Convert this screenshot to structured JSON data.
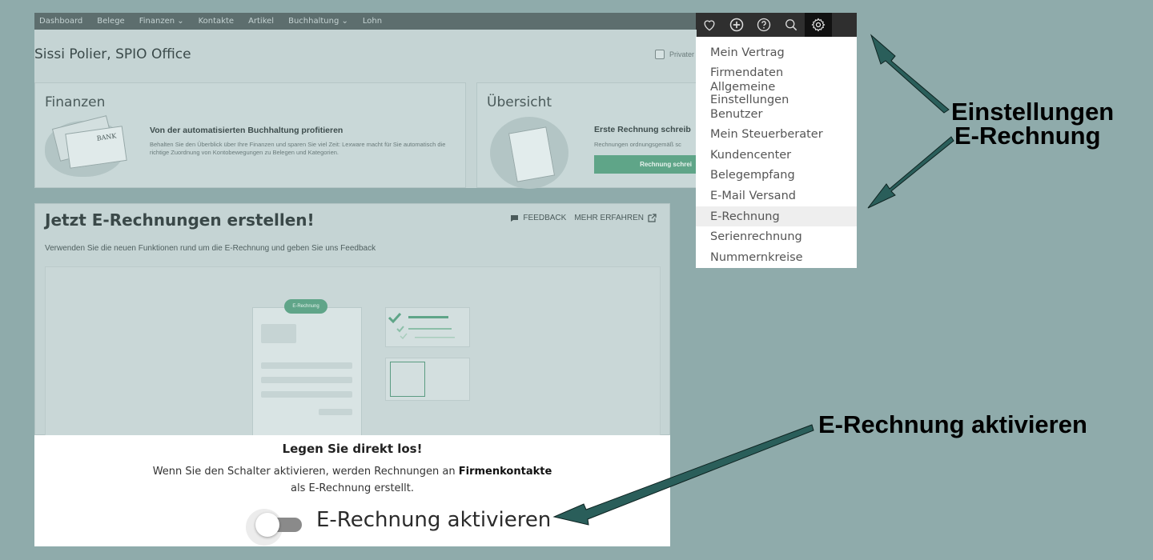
{
  "nav": {
    "items": [
      "Dashboard",
      "Belege",
      "Finanzen ⌄",
      "Kontakte",
      "Artikel",
      "Buchhaltung ⌄",
      "Lohn"
    ]
  },
  "toolbar": {
    "icons": [
      "heart-icon",
      "plus-circle-icon",
      "help-icon",
      "search-icon",
      "gear-icon"
    ]
  },
  "company": "Sissi Polier, SPIO Office",
  "private_label": "Privater",
  "finance_card": {
    "title": "Finanzen",
    "bank_label": "BANK",
    "headline": "Von der automatisierten Buchhaltung profitieren",
    "text": "Behalten Sie den Überblick über Ihre Finanzen und sparen Sie viel Zeit: Lexware macht für Sie automatisch die richtige Zuordnung von Kontobewegungen zu Belegen und Kategorien."
  },
  "overview_card": {
    "title": "Übersicht",
    "headline": "Erste Rechnung schreib",
    "text": "Rechnungen ordnungsgemäß sc",
    "button": "Rechnung schrei"
  },
  "einvoice": {
    "title": "Jetzt E-Rechnungen erstellen!",
    "feedback": "FEEDBACK",
    "more": "MEHR ERFAHREN",
    "subtitle": "Verwenden Sie die neuen Funktionen rund um die E-Rechnung und geben Sie uns Feedback",
    "pill": "E-Rechnung"
  },
  "activation": {
    "heading": "Legen Sie direkt los!",
    "text_pre": "Wenn Sie den Schalter aktivieren, werden Rechnungen an ",
    "text_bold": "Firmenkontakte",
    "text_line2": "als E-Rechnung erstellt.",
    "toggle_label": "E-Rechnung aktivieren",
    "toggle_on": false
  },
  "menu": {
    "items": [
      "Mein Vertrag",
      "Firmendaten",
      "Allgemeine Einstellungen",
      "Benutzer",
      "Mein Steuerberater",
      "Kundencenter",
      "Belegempfang",
      "E-Mail Versand",
      "E-Rechnung",
      "Serienrechnung",
      "Nummernkreise"
    ],
    "highlighted": "E-Rechnung"
  },
  "annotations": {
    "line1": "Einstellungen",
    "line2": "E-Rechnung",
    "line3": "E-Rechnung aktivieren"
  },
  "colors": {
    "background": "#8fabab",
    "arrow": "#2a5e5a",
    "accent_green": "#5fa588"
  }
}
